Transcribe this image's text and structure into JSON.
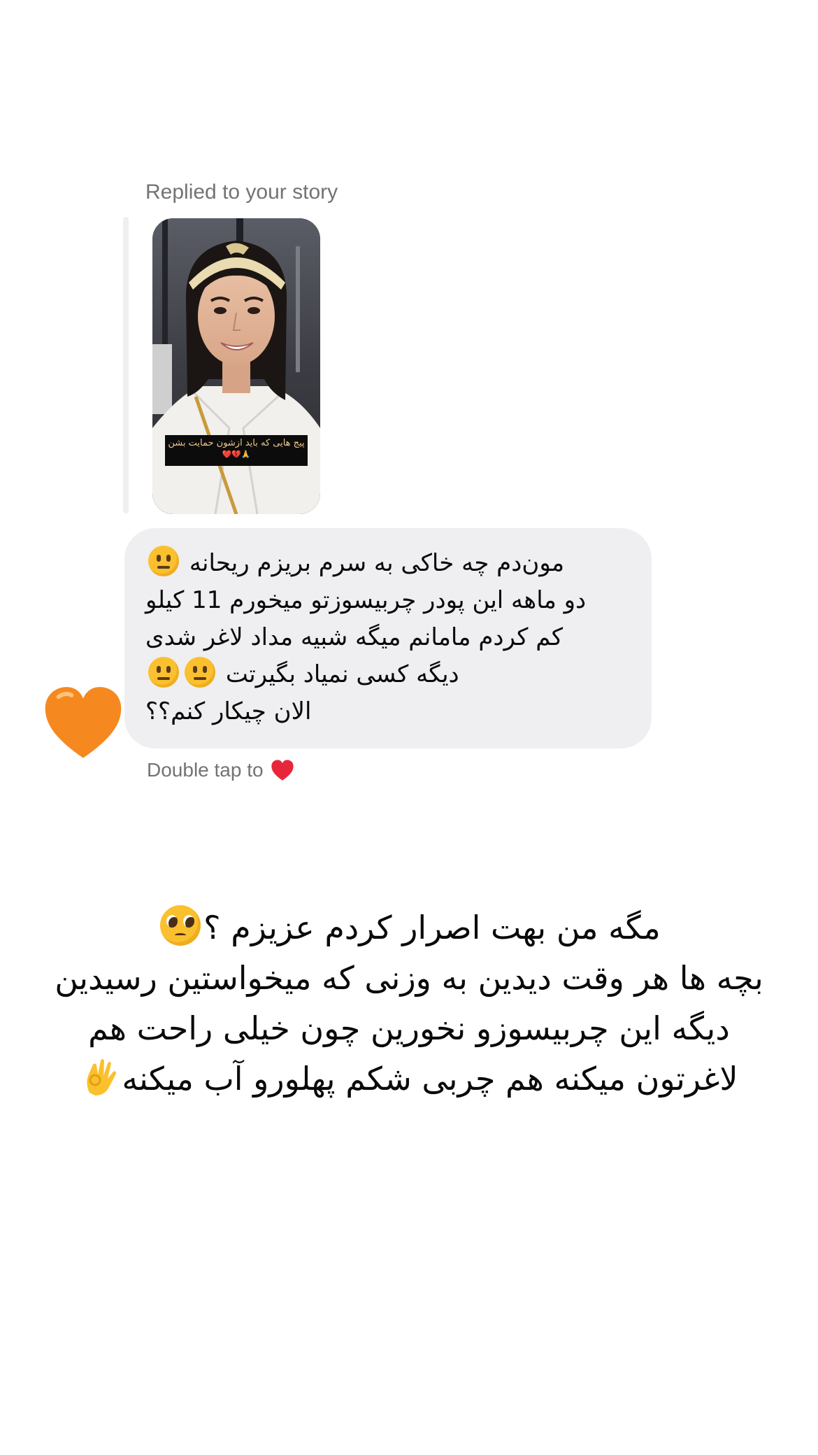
{
  "story_reply": {
    "label": "Replied to your story",
    "story_caption": "پیج هایی که باید ازشون حمایت بشن",
    "story_caption_emoji": "🙏💔❤️"
  },
  "message": {
    "lines": [
      "مون‌دم چه خاکی به سرم بریزم ریحانه",
      "دو ماهه این پودر چربیسوزتو میخورم 11 کیلو",
      "کم کردم مامانم میگه شبیه مداد لاغر شدی",
      "دیگه کسی نمیاد بگیرتت",
      "الان چیکار کنم؟؟"
    ],
    "emojis": [
      "neutral-face-emoji"
    ],
    "reaction": "orange-heart",
    "hint": "Double tap to",
    "hint_icon": "red-heart-icon"
  },
  "overlay_text": {
    "lines": [
      "مگه من بهت اصرار کردم عزیزم ؟",
      "بچه ها هر وقت دیدین به وزنی که میخواستین رسیدین",
      "دیگه این چربیسوزو نخورین چون خیلی راحت هم",
      "لاغرتون میکنه هم چربی شکم پهلورو آب میکنه"
    ],
    "emojis": [
      "pleading-face-emoji",
      "ok-hand-emoji"
    ]
  },
  "colors": {
    "bubble": "#efeff1",
    "secondary_text": "#737373",
    "heart_orange": "#f5891f",
    "heart_red": "#e8263b"
  }
}
